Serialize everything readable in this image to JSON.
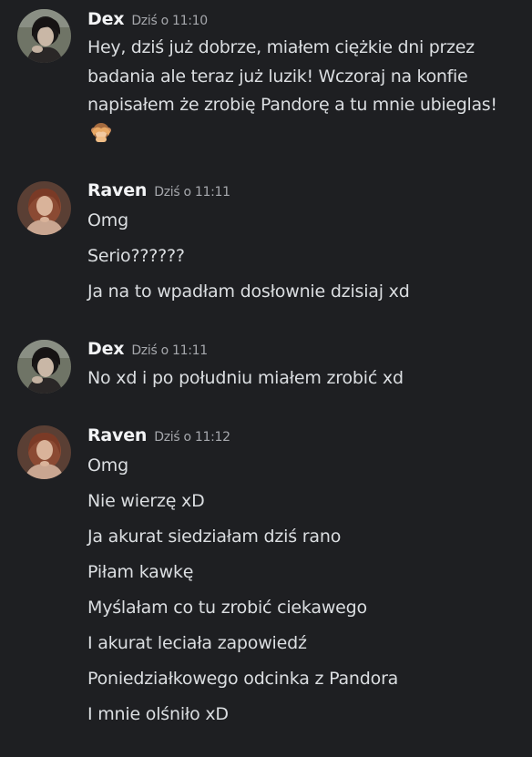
{
  "messages": [
    {
      "author": "Dex",
      "time": "Dziś o 11:10",
      "lines": [
        "Hey, dziś już dobrze, miałem ciężkie dni przez badania ale teraz już luzik!  Wczoraj na konfie napisałem że zrobię Pandorę a tu mnie ubieglas!"
      ],
      "emoji": "see-no-evil-monkey-icon"
    },
    {
      "author": "Raven",
      "time": "Dziś o 11:11",
      "lines": [
        "Omg",
        "Serio??????",
        "Ja na to wpadłam dosłownie dzisiaj xd"
      ]
    },
    {
      "author": "Dex",
      "time": "Dziś o 11:11",
      "lines": [
        "No xd i po południu miałem zrobić xd"
      ]
    },
    {
      "author": "Raven",
      "time": "Dziś o 11:12",
      "lines": [
        "Omg",
        "Nie wierzę xD",
        "Ja akurat siedziałam dziś rano",
        "Piłam kawkę",
        "Myślałam co tu zrobić ciekawego",
        "I akurat leciała zapowiedź",
        "Poniedziałkowego odcinka z Pandora",
        "I mnie olśniło xD"
      ]
    }
  ],
  "colors": {
    "background": "#1e1f22",
    "username": "#f2f3f5",
    "timestamp": "#a6a8ad",
    "text": "#dbdee1"
  }
}
